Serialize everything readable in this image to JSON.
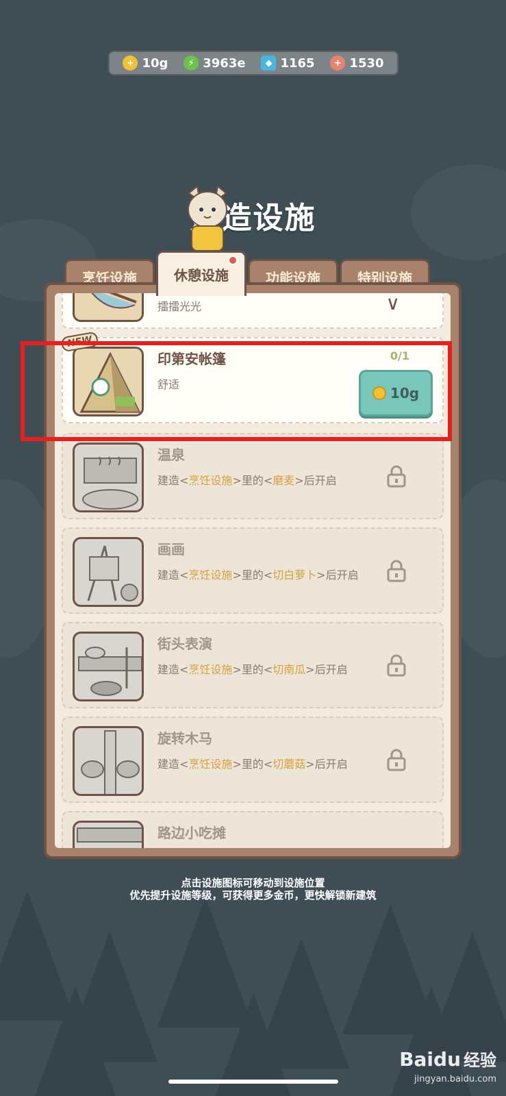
{
  "resources": [
    {
      "icon": "coin-icon",
      "value": "10g",
      "color": "#f0c233"
    },
    {
      "icon": "lightning-icon",
      "value": "3963e",
      "color": "#6cc24a"
    },
    {
      "icon": "gem-icon",
      "value": "1165",
      "color": "#45b7e0"
    },
    {
      "icon": "shell-icon",
      "value": "1530",
      "color": "#e8836e"
    }
  ],
  "title": "建造设施",
  "tabs": [
    {
      "label": "烹饪设施"
    },
    {
      "label": "休憩设施",
      "active": true
    },
    {
      "label": "功能设施"
    },
    {
      "label": "特别设施"
    }
  ],
  "items": [
    {
      "title": "",
      "desc": "擂擂光光",
      "state": "owned"
    },
    {
      "title": "印第安帐篷",
      "desc": "舒适",
      "state": "available",
      "badge": "NEW",
      "count": "0/1",
      "price": "10g"
    },
    {
      "title": "温泉",
      "desc_pre": "建造<",
      "desc_hl1": "烹饪设施",
      "desc_mid": ">里的<",
      "desc_hl2": "磨麦",
      "desc_post": ">后开启",
      "state": "locked"
    },
    {
      "title": "画画",
      "desc_pre": "建造<",
      "desc_hl1": "烹饪设施",
      "desc_mid": ">里的<",
      "desc_hl2": "切白萝卜",
      "desc_post": ">后开启",
      "state": "locked"
    },
    {
      "title": "街头表演",
      "desc_pre": "建造<",
      "desc_hl1": "烹饪设施",
      "desc_mid": ">里的<",
      "desc_hl2": "切南瓜",
      "desc_post": ">后开启",
      "state": "locked"
    },
    {
      "title": "旋转木马",
      "desc_pre": "建造<",
      "desc_hl1": "烹饪设施",
      "desc_mid": ">里的<",
      "desc_hl2": "切蘑菇",
      "desc_post": ">后开启",
      "state": "locked"
    },
    {
      "title": "路边小吃摊",
      "state": "locked"
    }
  ],
  "hint": {
    "line1": "点击设施图标可移动到设施位置",
    "line2": "优先提升设施等级，可获得更多金币，更快解锁新建筑"
  },
  "watermark": {
    "logo": "Baidu",
    "text": "经验",
    "url": "jingyan.baidu.com"
  }
}
